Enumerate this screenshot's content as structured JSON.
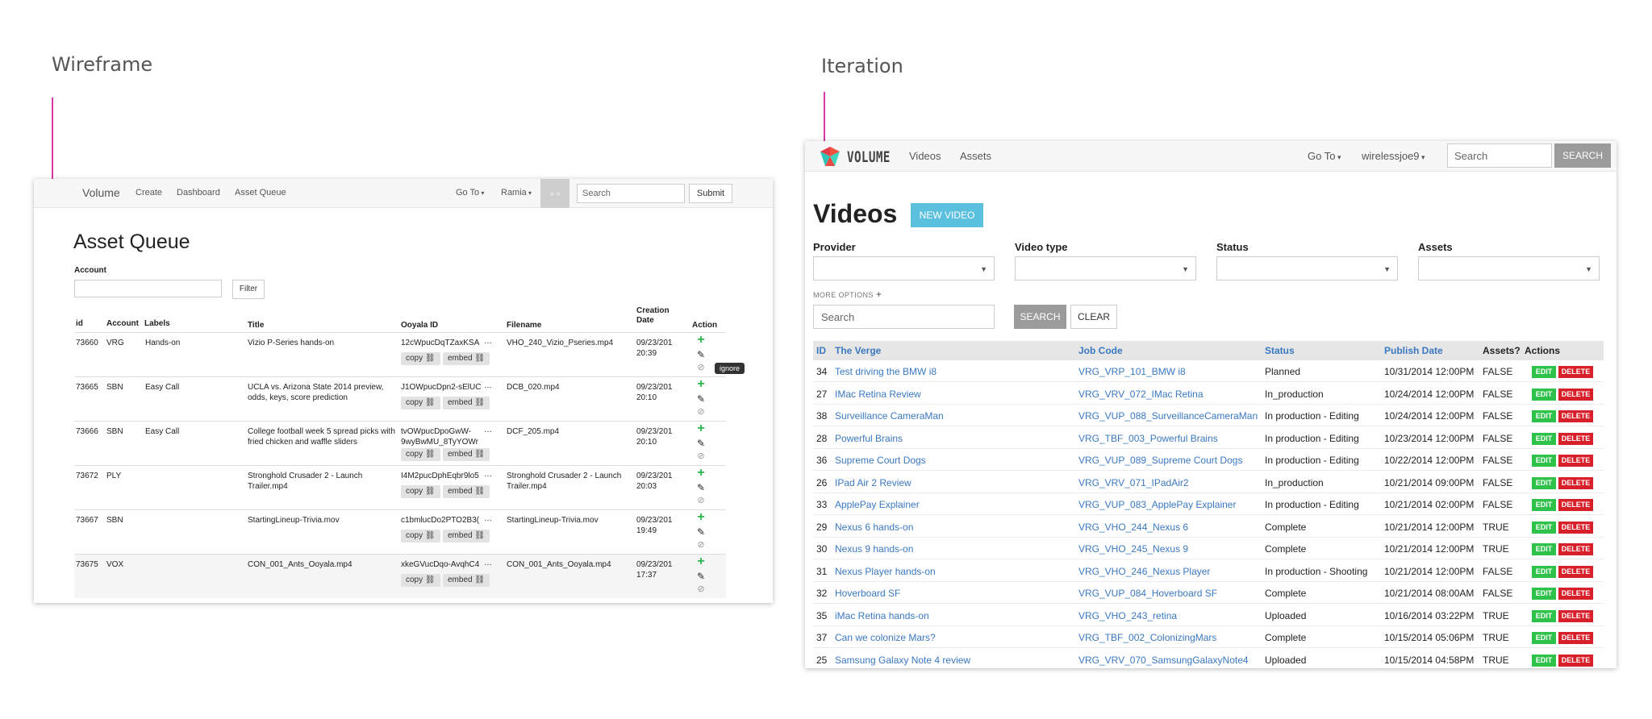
{
  "labels": {
    "wireframe": "Wireframe",
    "iteration": "Iteration"
  },
  "colors": {
    "accent_pink": "#d63aa5",
    "link_blue": "#3a78c0",
    "new_video": "#5bc0de",
    "edit_green": "#2ec24a",
    "delete_red": "#d8202a",
    "plus_green": "#2ab54a"
  },
  "wireframe": {
    "nav": {
      "brand": "Volume",
      "links": [
        "Create",
        "Dashboard",
        "Asset Queue"
      ],
      "goto": "Go To",
      "user": "Ramia",
      "grey_btn": "» »",
      "search_placeholder": "Search",
      "submit": "Submit"
    },
    "page_title": "Asset Queue",
    "account_label": "Account",
    "filter_button": "Filter",
    "columns": [
      "id",
      "Account",
      "Labels",
      "Title",
      "Ooyala ID",
      "Filename",
      "Creation Date",
      "Action"
    ],
    "chip_copy": "copy",
    "chip_embed": "embed",
    "tooltip": "ignore",
    "rows": [
      {
        "id": "73660",
        "account": "VRG",
        "label": "Hands-on",
        "title": "Vizio P-Series hands-on",
        "ooyala": "12cWpucDqTZaxKSA",
        "ooyala2": "",
        "filename": "VHO_240_Vizio_Pseries.mp4",
        "date": "09/23/201",
        "time": "20:39"
      },
      {
        "id": "73665",
        "account": "SBN",
        "label": "Easy Call",
        "title": "UCLA vs. Arizona State 2014 preview, odds, keys, score prediction",
        "ooyala": "J1OWpucDpn2-sElUC",
        "ooyala2": "",
        "filename": "DCB_020.mp4",
        "date": "09/23/201",
        "time": "20:10"
      },
      {
        "id": "73666",
        "account": "SBN",
        "label": "Easy Call",
        "title": "College football week 5 spread picks with fried chicken and waffle sliders",
        "ooyala": "tvOWpucDpoGwW-",
        "ooyala2": "9wyBwMU_8TyYOWr",
        "filename": "DCF_205.mp4",
        "date": "09/23/201",
        "time": "20:10"
      },
      {
        "id": "73672",
        "account": "PLY",
        "label": "",
        "title": "Stronghold Crusader 2 - Launch Trailer.mp4",
        "ooyala": "I4M2pucDphEqbr9lo5",
        "ooyala2": "",
        "filename": "Stronghold Crusader 2 - Launch Trailer.mp4",
        "date": "09/23/201",
        "time": "20:03"
      },
      {
        "id": "73667",
        "account": "SBN",
        "label": "",
        "title": "StartingLineup-Trivia.mov",
        "ooyala": "c1bmlucDo2PTO2B3(",
        "ooyala2": "",
        "filename": "StartingLineup-Trivia.mov",
        "date": "09/23/201",
        "time": "19:49"
      },
      {
        "id": "73675",
        "account": "VOX",
        "label": "",
        "title": "CON_001_Ants_Ooyala.mp4",
        "ooyala": "xkeGVucDqo-AvqhC4",
        "ooyala2": "",
        "filename": "CON_001_Ants_Ooyala.mp4",
        "date": "09/23/201",
        "time": "17:37"
      }
    ]
  },
  "iteration": {
    "nav": {
      "brand": "VOLUME",
      "links": [
        "Videos",
        "Assets"
      ],
      "goto": "Go To",
      "user": "wirelessjoe9",
      "search_placeholder": "Search",
      "search_button": "SEARCH"
    },
    "page_title": "Videos",
    "new_video": "NEW VIDEO",
    "filters": [
      "Provider",
      "Video type",
      "Status",
      "Assets"
    ],
    "more_options": "MORE OPTIONS",
    "search_placeholder": "Search",
    "search_button": "SEARCH",
    "clear_button": "CLEAR",
    "columns": [
      "ID",
      "The Verge",
      "Job Code",
      "Status",
      "Publish Date",
      "Assets?",
      "Actions"
    ],
    "edit": "EDIT",
    "delete": "DELETE",
    "rows": [
      {
        "id": "34",
        "title": "Test driving the BMW i8",
        "job": "VRG_VRP_101_BMW i8",
        "status": "Planned",
        "date": "10/31/2014 12:00PM",
        "assets": "FALSE"
      },
      {
        "id": "27",
        "title": "IMac Retina Review",
        "job": "VRG_VRV_072_IMac Retina",
        "status": "In_production",
        "date": "10/24/2014 12:00PM",
        "assets": "FALSE"
      },
      {
        "id": "38",
        "title": "Surveillance CameraMan",
        "job": "VRG_VUP_088_SurveillanceCameraMan",
        "status": "In production - Editing",
        "date": "10/24/2014 12:00PM",
        "assets": "FALSE"
      },
      {
        "id": "28",
        "title": "Powerful Brains",
        "job": "VRG_TBF_003_Powerful Brains",
        "status": "In production - Editing",
        "date": "10/23/2014 12:00PM",
        "assets": "FALSE"
      },
      {
        "id": "36",
        "title": "Supreme Court Dogs",
        "job": "VRG_VUP_089_Supreme Court Dogs",
        "status": "In production - Editing",
        "date": "10/22/2014 12:00PM",
        "assets": "FALSE"
      },
      {
        "id": "26",
        "title": "IPad Air 2 Review",
        "job": "VRG_VRV_071_IPadAir2",
        "status": "In_production",
        "date": "10/21/2014 09:00PM",
        "assets": "FALSE"
      },
      {
        "id": "33",
        "title": "ApplePay Explainer",
        "job": "VRG_VUP_083_ApplePay Explainer",
        "status": "In production - Editing",
        "date": "10/21/2014 02:00PM",
        "assets": "FALSE"
      },
      {
        "id": "29",
        "title": "Nexus 6 hands-on",
        "job": "VRG_VHO_244_Nexus 6",
        "status": "Complete",
        "date": "10/21/2014 12:00PM",
        "assets": "TRUE"
      },
      {
        "id": "30",
        "title": "Nexus 9 hands-on",
        "job": "VRG_VHO_245_Nexus 9",
        "status": "Complete",
        "date": "10/21/2014 12:00PM",
        "assets": "TRUE"
      },
      {
        "id": "31",
        "title": "Nexus Player hands-on",
        "job": "VRG_VHO_246_Nexus Player",
        "status": "In production - Shooting",
        "date": "10/21/2014 12:00PM",
        "assets": "FALSE"
      },
      {
        "id": "32",
        "title": "Hoverboard SF",
        "job": "VRG_VUP_084_Hoverboard SF",
        "status": "Complete",
        "date": "10/21/2014 08:00AM",
        "assets": "FALSE"
      },
      {
        "id": "35",
        "title": "iMac Retina hands-on",
        "job": "VRG_VHO_243_retina",
        "status": "Uploaded",
        "date": "10/16/2014 03:22PM",
        "assets": "TRUE"
      },
      {
        "id": "37",
        "title": "Can we colonize Mars?",
        "job": "VRG_TBF_002_ColonizingMars",
        "status": "Complete",
        "date": "10/15/2014 05:06PM",
        "assets": "TRUE"
      },
      {
        "id": "25",
        "title": "Samsung Galaxy Note 4 review",
        "job": "VRG_VRV_070_SamsungGalaxyNote4",
        "status": "Uploaded",
        "date": "10/15/2014 04:58PM",
        "assets": "TRUE"
      }
    ]
  }
}
